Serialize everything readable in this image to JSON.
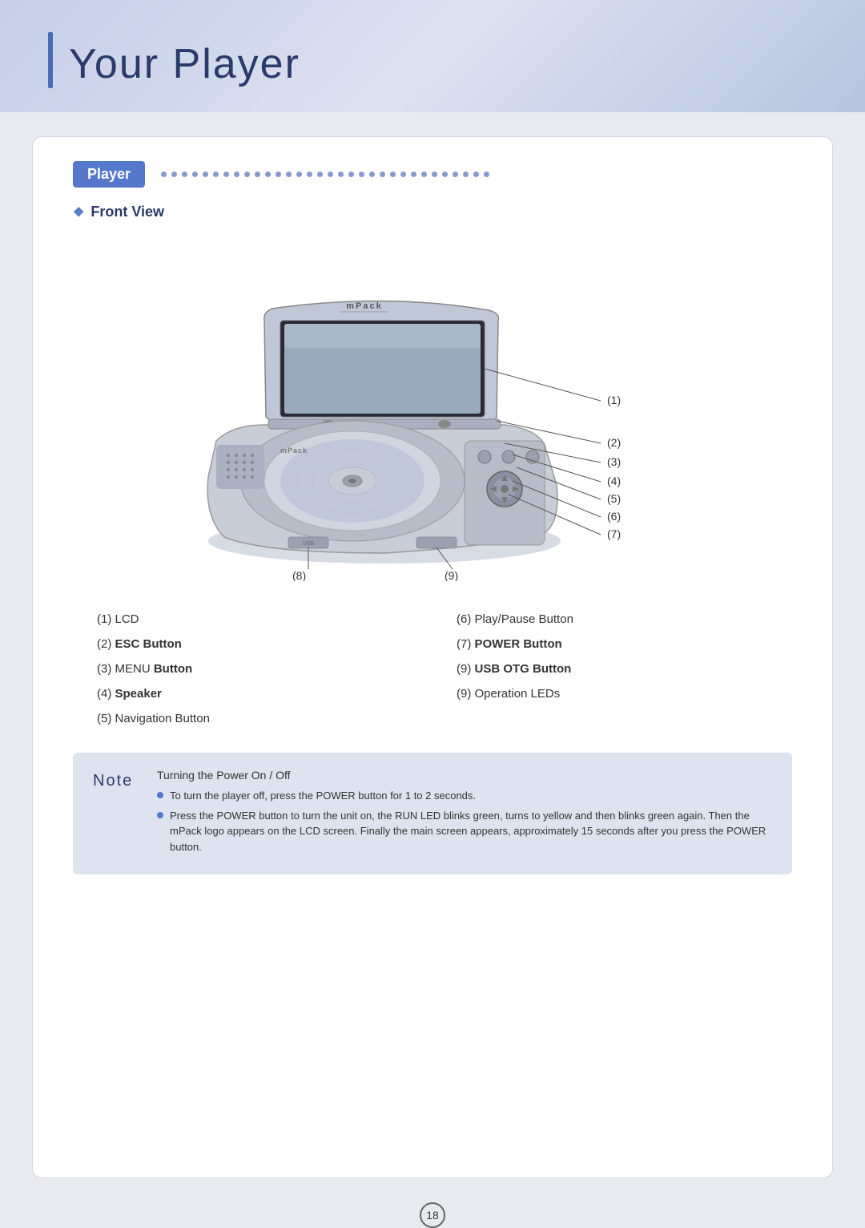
{
  "header": {
    "title": "Your Player",
    "bar_color": "#4a6cb3"
  },
  "section": {
    "badge": "Player",
    "sub_title": "Front View",
    "dot_count": 32
  },
  "device": {
    "brand": "mPack",
    "callouts": [
      "(1)",
      "(2)",
      "(3)",
      "(4)",
      "(5)",
      "(6)",
      "(7)"
    ],
    "bottom_labels": [
      {
        "id": "(8)",
        "x": "left"
      },
      {
        "id": "(9)",
        "x": "right"
      }
    ]
  },
  "parts": [
    {
      "id": "(1)",
      "label": "LCD"
    },
    {
      "id": "(6)",
      "label": "Play/Pause Button"
    },
    {
      "id": "(2)",
      "label": "ESC Button",
      "bold": true
    },
    {
      "id": "(7)",
      "label": "POWER Button",
      "bold": true
    },
    {
      "id": "(3)",
      "label": "MENU",
      "label2": "Button",
      "bold2": true
    },
    {
      "id": "(9)",
      "label": "USB OTG Button",
      "bold": true
    },
    {
      "id": "(4)",
      "label": "Speaker",
      "bold": true
    },
    {
      "id": "(9b)",
      "label": "Operation LEDs"
    },
    {
      "id": "(5)",
      "label": "Navigation Button"
    }
  ],
  "note": {
    "label": "Note",
    "title": "Turning the Power On / Off",
    "bullets": [
      "To turn the player off, press the POWER button for 1 to 2 seconds.",
      "Press the POWER button to turn the unit on, the RUN LED blinks green, turns to yellow and then blinks green again. Then the mPack logo appears on the LCD screen. Finally the main screen appears, approximately 15 seconds after you press the POWER button."
    ]
  },
  "page_number": "18"
}
